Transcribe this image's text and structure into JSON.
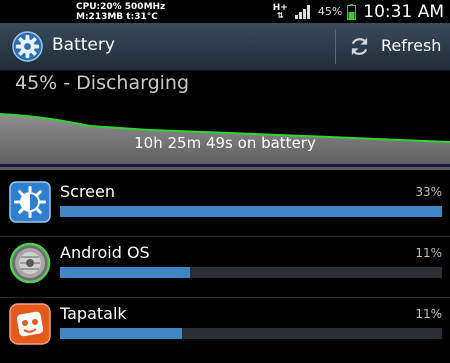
{
  "status_bar": {
    "cpu_line1": "CPU:20% 500MHz",
    "cpu_line2": "M:213MB t:31°C",
    "network": "H+",
    "battery_percent": "45%",
    "time": "10:31 AM"
  },
  "action_bar": {
    "title": "Battery",
    "refresh_label": "Refresh",
    "app_icon": "gear-icon",
    "refresh_icon": "refresh-icon"
  },
  "status_text": "45% - Discharging",
  "graph": {
    "label": "10h 25m 49s on battery",
    "line_color": "#2fd62f"
  },
  "usage": [
    {
      "name": "Screen",
      "percent_text": "33%",
      "fraction": 1.0,
      "icon": "screen-brightness-icon"
    },
    {
      "name": "Android OS",
      "percent_text": "11%",
      "fraction": 0.34,
      "icon": "android-os-icon"
    },
    {
      "name": "Tapatalk",
      "percent_text": "11%",
      "fraction": 0.32,
      "icon": "tapatalk-icon"
    }
  ],
  "colors": {
    "accent": "#3e86c4",
    "battery_icon": "#33cc33",
    "action_bar": "#2b3a48"
  }
}
